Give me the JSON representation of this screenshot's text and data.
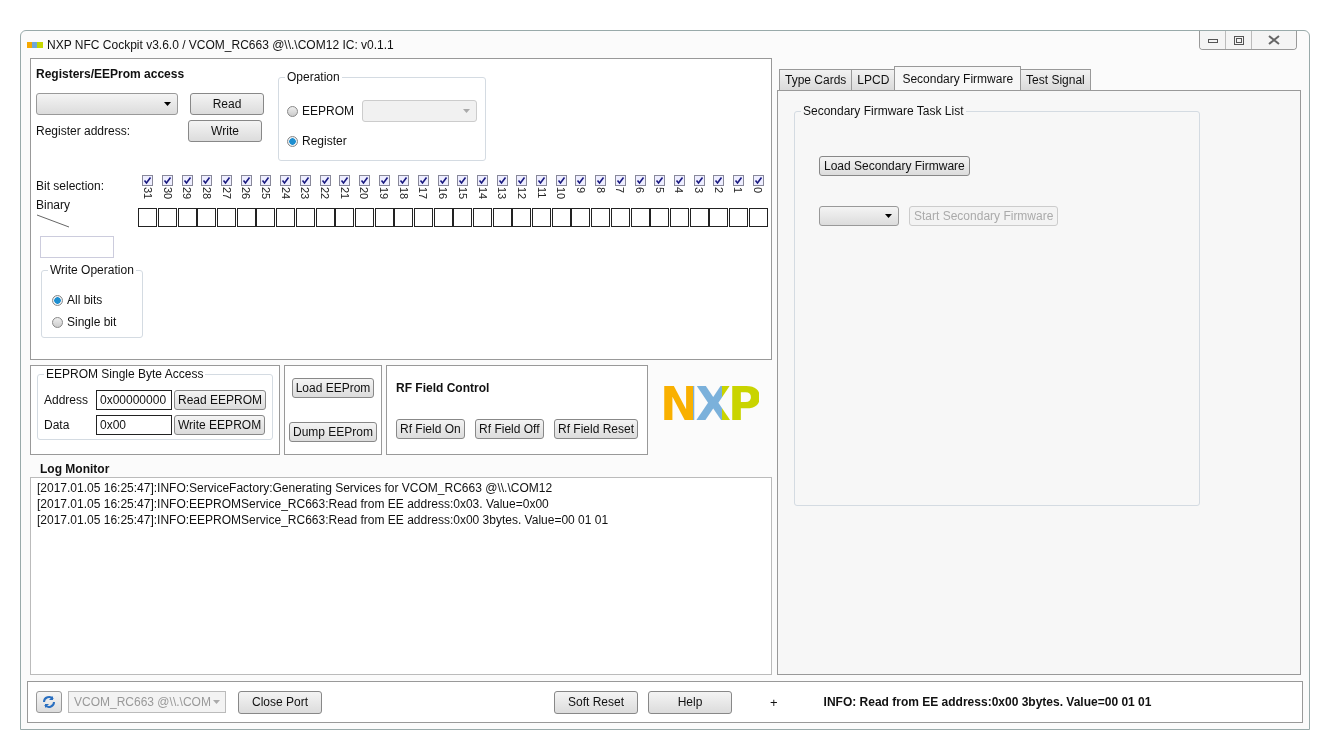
{
  "window": {
    "title": "NXP NFC Cockpit v3.6.0 / VCOM_RC663 @\\\\.\\COM12  IC: v0.1.1"
  },
  "registers": {
    "title": "Registers/EEProm access",
    "read_button": "Read",
    "write_button": "Write",
    "address_label": "Register address:",
    "operation": {
      "title": "Operation",
      "options": [
        {
          "label": "EEPROM",
          "selected": false
        },
        {
          "label": "Register",
          "selected": true
        }
      ]
    },
    "bit_selection_label": "Bit selection:",
    "binary_label": "Binary",
    "bits": [
      {
        "label": "31",
        "checked": true
      },
      {
        "label": "30",
        "checked": true
      },
      {
        "label": "29",
        "checked": true
      },
      {
        "label": "28",
        "checked": true
      },
      {
        "label": "27",
        "checked": true
      },
      {
        "label": "26",
        "checked": true
      },
      {
        "label": "25",
        "checked": true
      },
      {
        "label": "24",
        "checked": true
      },
      {
        "label": "23",
        "checked": true
      },
      {
        "label": "22",
        "checked": true
      },
      {
        "label": "21",
        "checked": true
      },
      {
        "label": "20",
        "checked": true
      },
      {
        "label": "19",
        "checked": true
      },
      {
        "label": "18",
        "checked": true
      },
      {
        "label": "17",
        "checked": true
      },
      {
        "label": "16",
        "checked": true
      },
      {
        "label": "15",
        "checked": true
      },
      {
        "label": "14",
        "checked": true
      },
      {
        "label": "13",
        "checked": true
      },
      {
        "label": "12",
        "checked": true
      },
      {
        "label": "11",
        "checked": true
      },
      {
        "label": "10",
        "checked": true
      },
      {
        "label": "9",
        "checked": true
      },
      {
        "label": "8",
        "checked": true
      },
      {
        "label": "7",
        "checked": true
      },
      {
        "label": "6",
        "checked": true
      },
      {
        "label": "5",
        "checked": true
      },
      {
        "label": "4",
        "checked": true
      },
      {
        "label": "3",
        "checked": true
      },
      {
        "label": "2",
        "checked": true
      },
      {
        "label": "1",
        "checked": true
      },
      {
        "label": "0",
        "checked": true
      }
    ],
    "write_operation": {
      "title": "Write Operation",
      "options": [
        {
          "label": "All bits",
          "selected": true
        },
        {
          "label": "Single bit",
          "selected": false
        }
      ]
    }
  },
  "eeprom_access": {
    "title": "EEPROM Single Byte Access",
    "address_label": "Address",
    "address_value": "0x00000000",
    "read_button": "Read EEPROM",
    "data_label": "Data",
    "data_value": "0x00",
    "write_button": "Write EEPROM"
  },
  "eeprom_buttons": [
    "Load EEProm",
    "Dump EEProm"
  ],
  "rf_field": {
    "title": "RF Field Control",
    "buttons": [
      "Rf Field On",
      "Rf Field Off",
      "Rf Field Reset"
    ]
  },
  "logo": "NXP",
  "log": {
    "title": "Log Monitor",
    "lines": [
      "[2017.01.05 16:25:47]:INFO:ServiceFactory:Generating Services for VCOM_RC663 @\\\\.\\COM12",
      "[2017.01.05 16:25:47]:INFO:EEPROMService_RC663:Read from EE address:0x03. Value=0x00",
      "[2017.01.05 16:25:47]:INFO:EEPROMService_RC663:Read from EE address:0x00 3bytes. Value=00 01 01"
    ]
  },
  "tabs": [
    {
      "label": "Type Cards",
      "selected": false
    },
    {
      "label": "LPCD",
      "selected": false
    },
    {
      "label": "Secondary Firmware",
      "selected": true
    },
    {
      "label": "Test Signal",
      "selected": false
    }
  ],
  "secondary_firmware": {
    "title": "Secondary Firmware Task List",
    "load_button": "Load Secondary Firmware",
    "start_button": {
      "label": "Start Secondary Firmware",
      "disabled": true
    }
  },
  "bottom_bar": {
    "port": {
      "value": "VCOM_RC663 @\\\\.\\COM",
      "disabled": true
    },
    "close_button": "Close Port",
    "soft_reset_button": "Soft Reset",
    "help_button": "Help",
    "plus": "+",
    "status": "INFO: Read from EE address:0x00 3bytes. Value=00 01 01"
  }
}
